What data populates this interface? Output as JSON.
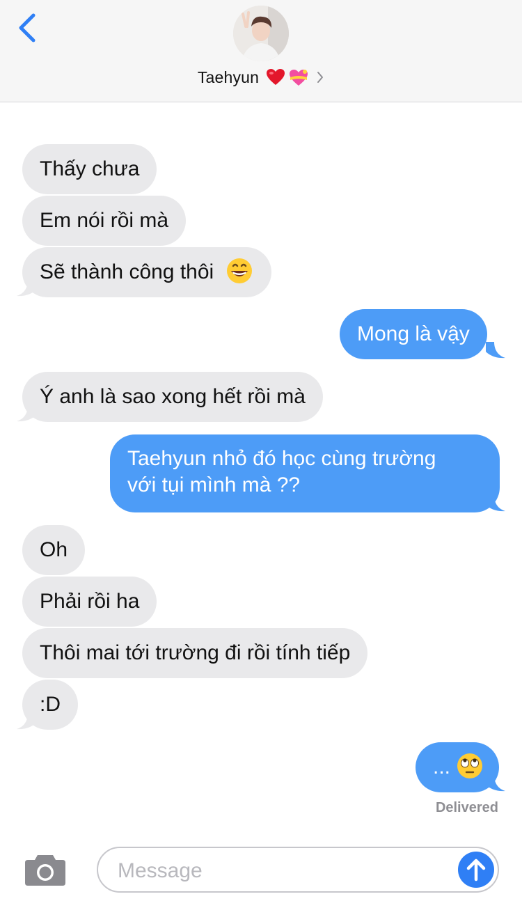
{
  "header": {
    "contact_name": "Taehyun",
    "icons": [
      "back-chevron-icon",
      "red-heart-icon",
      "heart-with-ribbon-icon",
      "chevron-right-icon"
    ]
  },
  "messages": [
    {
      "dir": "in",
      "text": "Thấy chưa"
    },
    {
      "dir": "in",
      "text": "Em nói rồi mà"
    },
    {
      "dir": "in",
      "text": "Sẽ thành công thôi",
      "emoji": "grinning-face-icon"
    },
    {
      "dir": "out",
      "text": "Mong là vậy"
    },
    {
      "dir": "in",
      "text": "Ý anh là sao xong hết rồi mà"
    },
    {
      "dir": "out",
      "line1": "Taehyun nhỏ đó học cùng trường",
      "line2": "với tụi mình mà ??"
    },
    {
      "dir": "in",
      "text": "Oh"
    },
    {
      "dir": "in",
      "text": "Phải rồi ha"
    },
    {
      "dir": "in",
      "text": "Thôi mai tới trường đi rồi tính tiếp"
    },
    {
      "dir": "in",
      "text": ":D"
    },
    {
      "dir": "out",
      "text": "...",
      "emoji": "eye-roll-face-icon"
    }
  ],
  "status": {
    "delivered": "Delivered"
  },
  "composer": {
    "placeholder": "Message",
    "icons": [
      "camera-icon",
      "send-arrow-icon"
    ]
  },
  "colors": {
    "incoming_bubble": "#e9e9eb",
    "outgoing_bubble": "#4d9cf7",
    "accent": "#2f7ff5"
  }
}
